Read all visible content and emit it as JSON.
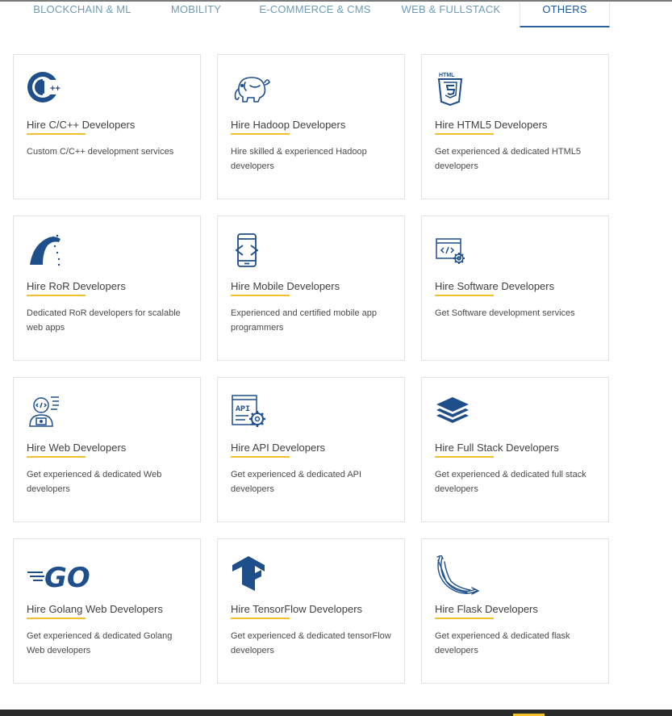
{
  "tabs": [
    {
      "label": "BLOCKCHAIN & ML",
      "active": false
    },
    {
      "label": "MOBILITY",
      "active": false
    },
    {
      "label": "E-COMMERCE & CMS",
      "active": false
    },
    {
      "label": "WEB & FULLSTACK",
      "active": false
    },
    {
      "label": "OTHERS",
      "active": true
    }
  ],
  "cards": [
    {
      "icon": "cpp-icon",
      "title": "Hire C/C++ Developers",
      "desc": "Custom C/C++ development services"
    },
    {
      "icon": "hadoop-elephant-icon",
      "title": "Hire Hadoop Developers",
      "desc": "Hire skilled & experienced Hadoop developers"
    },
    {
      "icon": "html5-icon",
      "title": "Hire HTML5 Developers",
      "desc": "Get experienced & dedicated HTML5 developers"
    },
    {
      "icon": "ruby-on-rails-icon",
      "title": "Hire RoR Developers",
      "desc": "Dedicated RoR developers for scalable web apps"
    },
    {
      "icon": "mobile-phone-icon",
      "title": "Hire Mobile Developers",
      "desc": "Experienced and certified mobile app programmers"
    },
    {
      "icon": "software-code-gear-icon",
      "title": "Hire Software Developers",
      "desc": "Get Software development services"
    },
    {
      "icon": "web-developer-icon",
      "title": "Hire Web Developers",
      "desc": "Get experienced & dedicated Web developers"
    },
    {
      "icon": "api-gear-icon",
      "title": "Hire API Developers",
      "desc": "Get experienced & dedicated API developers"
    },
    {
      "icon": "stack-layers-icon",
      "title": "Hire Full Stack Developers",
      "desc": "Get experienced & dedicated full stack developers"
    },
    {
      "icon": "golang-go-icon",
      "title": "Hire Golang Web Developers",
      "desc": "Get experienced & dedicated Golang Web developers"
    },
    {
      "icon": "tensorflow-icon",
      "title": "Hire TensorFlow Developers",
      "desc": "Get experienced & dedicated tensorFlow developers"
    },
    {
      "icon": "flask-icon",
      "title": "Hire Flask Developers",
      "desc": "Get experienced & dedicated flask developers"
    }
  ],
  "colors": {
    "icon_blue": "#1e4f8a",
    "accent_yellow": "#f2c12e",
    "tab_inactive": "#6f9bb5",
    "tab_active": "#1b5aa2"
  }
}
